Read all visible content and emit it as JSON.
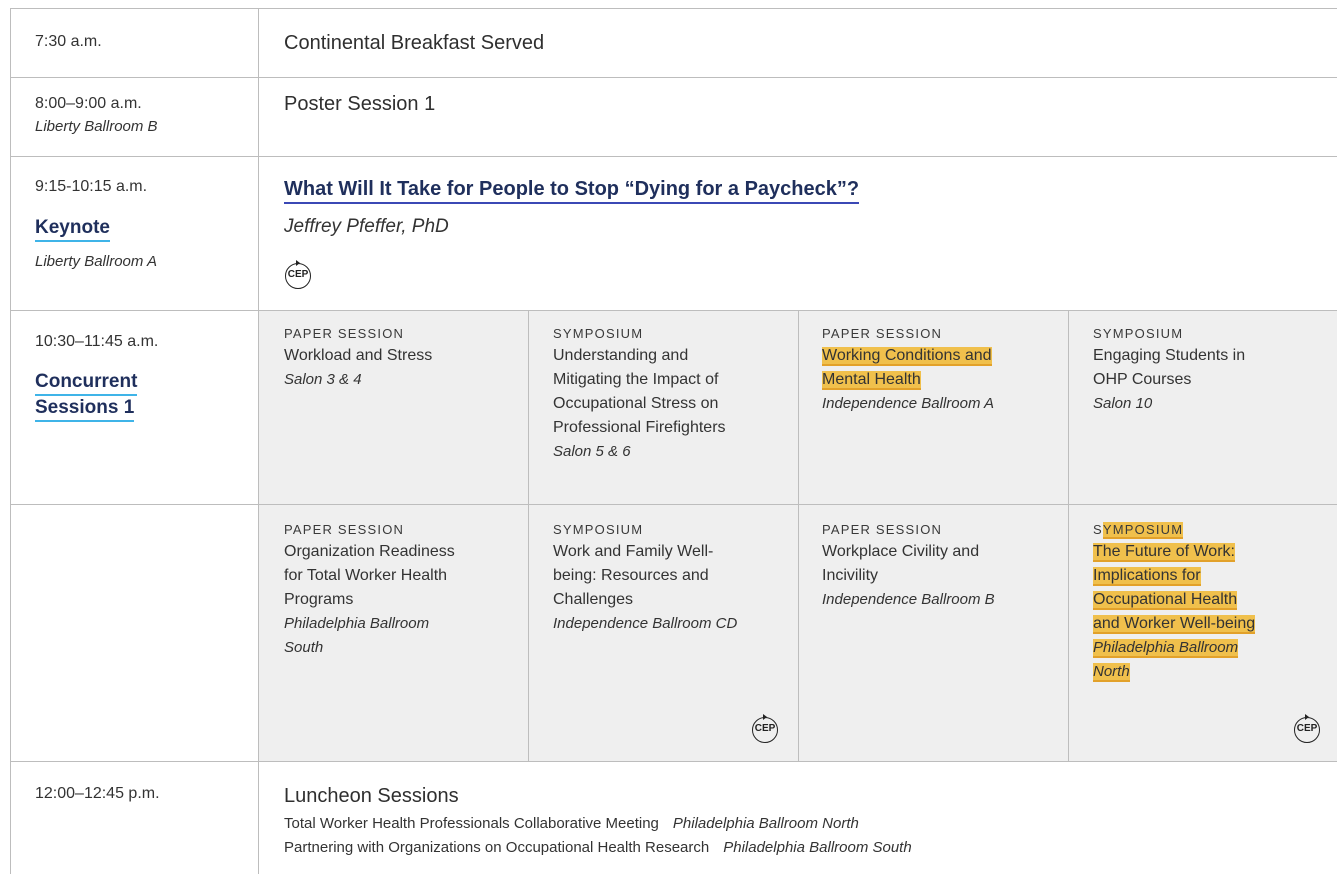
{
  "rows": {
    "breakfast": {
      "time": "7:30 a.m.",
      "title": "Continental Breakfast Served"
    },
    "poster": {
      "time": "8:00–9:00 a.m.",
      "room": "Liberty Ballroom B",
      "title": "Poster Session 1"
    },
    "keynote": {
      "time": "9:15-10:15 a.m.",
      "label": "Keynote",
      "room": "Liberty Ballroom A",
      "title": "What Will It Take for People to Stop “Dying for a Paycheck”?",
      "speaker": "Jeffrey Pfeffer, PhD",
      "badge": "CEP"
    },
    "concurrent": {
      "time": "10:30–11:45 a.m.",
      "label_line1": "Concurrent",
      "label_line2": "Sessions 1"
    },
    "luncheon": {
      "time": "12:00–12:45 p.m.",
      "title": "Luncheon Sessions",
      "items": [
        {
          "name": "Total Worker Health Professionals Collaborative Meeting",
          "room": "Philadelphia Ballroom North"
        },
        {
          "name": "Partnering with Organizations on Occupational Health Research",
          "room": "Philadelphia Ballroom South"
        }
      ]
    }
  },
  "sessions": [
    {
      "type": "PAPER SESSION",
      "lines": [
        "Workload and Stress"
      ],
      "room_lines": [
        "Salon 3 & 4"
      ]
    },
    {
      "type": "SYMPOSIUM",
      "lines": [
        "Understanding and",
        "Mitigating the Impact of",
        "Occupational Stress on",
        "Professional Firefighters"
      ],
      "room_lines": [
        "Salon 5 & 6"
      ]
    },
    {
      "type": "PAPER SESSION",
      "lines": [
        "Working Conditions and",
        "Mental Health"
      ],
      "room_lines": [
        "Independence Ballroom A"
      ],
      "highlight": "title"
    },
    {
      "type": "SYMPOSIUM",
      "lines": [
        "Engaging Students in",
        "OHP Courses"
      ],
      "room_lines": [
        "Salon 10"
      ]
    },
    {
      "type": "PAPER SESSION",
      "lines": [
        "Organization Readiness",
        "for Total Worker Health",
        "Programs"
      ],
      "room_lines": [
        "Philadelphia Ballroom",
        "South"
      ]
    },
    {
      "type": "SYMPOSIUM",
      "lines": [
        "Work and Family Well-",
        "being: Resources and",
        "Challenges"
      ],
      "room_lines": [
        "Independence Ballroom CD"
      ],
      "badge": "CEP"
    },
    {
      "type": "PAPER SESSION",
      "lines": [
        "Workplace Civility and",
        "Incivility"
      ],
      "room_lines": [
        "Independence Ballroom B"
      ]
    },
    {
      "type_prefix": "S",
      "type_rest": "YMPOSIUM",
      "lines": [
        "The Future of Work:",
        "Implications for",
        "Occupational Health",
        "and Worker Well-being"
      ],
      "room_lines": [
        "Philadelphia Ballroom",
        "North"
      ],
      "highlight": "all",
      "badge": "CEP"
    }
  ],
  "colors": {
    "highlight": "#f0c04c",
    "link_underline": "#3b48b5",
    "side_link_underline": "#3fb4e8",
    "grey_cell": "#efefef",
    "rule": "#bdbdbd"
  }
}
